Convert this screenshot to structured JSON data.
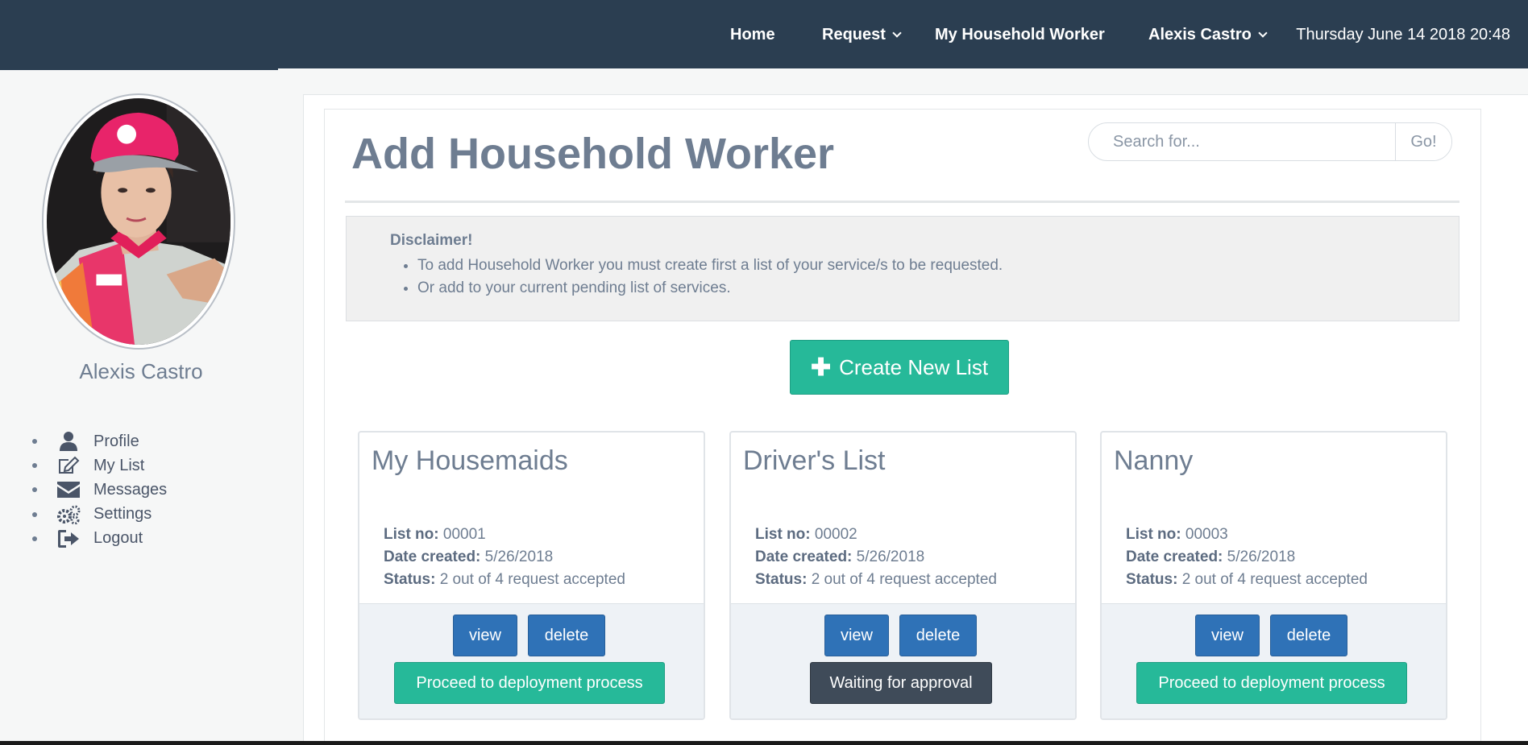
{
  "nav": {
    "items": [
      {
        "label": "Home",
        "dropdown": false
      },
      {
        "label": "Request",
        "dropdown": true
      },
      {
        "label": "My Household Worker",
        "dropdown": false
      },
      {
        "label": "Alexis Castro",
        "dropdown": true
      }
    ],
    "datetime": "Thursday June 14 2018 20:48"
  },
  "sidebar": {
    "user_name": "Alexis Castro",
    "menu": [
      {
        "label": "Profile",
        "icon": "user-icon"
      },
      {
        "label": "My List",
        "icon": "edit-icon"
      },
      {
        "label": "Messages",
        "icon": "envelope-icon"
      },
      {
        "label": "Settings",
        "icon": "gears-icon"
      },
      {
        "label": "Logout",
        "icon": "sign-out-icon"
      }
    ]
  },
  "main": {
    "title": "Add Household Worker",
    "search": {
      "placeholder": "Search for...",
      "button": "Go!"
    },
    "disclaimer": {
      "heading": "Disclaimer!",
      "items": [
        "To add Household Worker you must create first a list of your service/s to be requested.",
        "Or add to your current pending list of services."
      ]
    },
    "create_button": "Create New List",
    "labels": {
      "list_no": "List no:",
      "date_created": "Date created:",
      "status": "Status:"
    },
    "cards": [
      {
        "title": "My Housemaids",
        "list_no": "00001",
        "date_created": "5/26/2018",
        "status": "2 out of 4 request accepted",
        "view": "view",
        "delete": "delete",
        "action": "Proceed to deployment process",
        "action_type": "proceed"
      },
      {
        "title": "Driver's List",
        "list_no": "00002",
        "date_created": "5/26/2018",
        "status": "2 out of 4 request accepted",
        "view": "view",
        "delete": "delete",
        "action": "Waiting for approval",
        "action_type": "waiting"
      },
      {
        "title": "Nanny",
        "list_no": "00003",
        "date_created": "5/26/2018",
        "status": "2 out of 4 request accepted",
        "view": "view",
        "delete": "delete",
        "action": "Proceed to deployment process",
        "action_type": "proceed"
      }
    ]
  },
  "colors": {
    "navbar": "#2b3e51",
    "primary": "#2f72b7",
    "success": "#26b999",
    "dark": "#3f4b59",
    "text": "#6e7d91"
  }
}
